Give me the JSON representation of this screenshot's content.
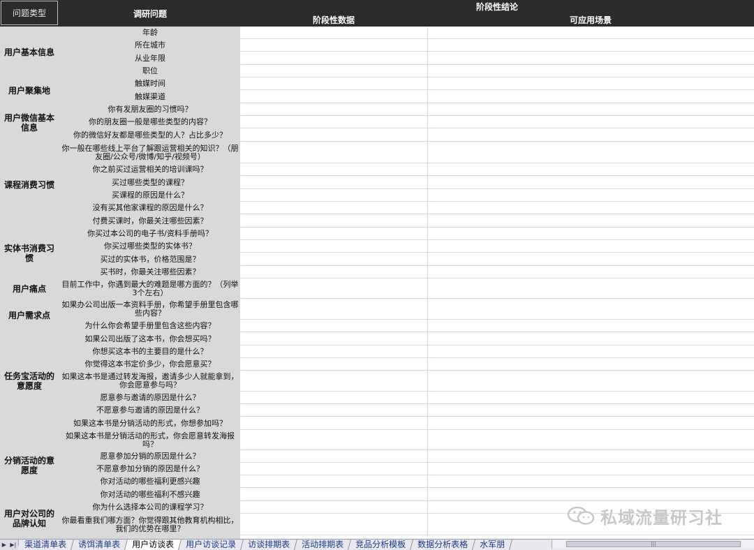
{
  "header": {
    "type_label": "问题类型",
    "question_label": "调研问题",
    "conclusion_label": "阶段性结论",
    "data_label": "阶段性数据",
    "scenario_label": "可应用场景"
  },
  "questions": [
    "年龄",
    "所在城市",
    "从业年限",
    "职位",
    "触媒时间",
    "触媒渠道",
    "你有发朋友圈的习惯吗？",
    "你的朋友圈一般是哪些类型的内容？",
    "你的微信好友都是哪些类型的人？占比多少？",
    "你一般在哪些线上平台了解跟运营相关的知识？（朋友圈/公众号/微博/知乎/视频号）",
    "你之前买过运营相关的培训课吗？",
    "买过哪些类型的课程？",
    "买课程的原因是什么？",
    "没有买其他家课程的原因是什么？",
    "付费买课时，你最关注哪些因素？",
    "你买过本公司的电子书/资料手册吗？",
    "你买过哪些类型的实体书？",
    "买过的实体书，价格范围是？",
    "买书时，你最关注哪些因素？",
    "目前工作中，你遇到最大的难题是哪方面的？（列举3个左右）",
    "如果办公司出版一本资料手册，你希望手册里包含哪些内容？",
    "为什么你会希望手册里包含这些内容？",
    "如果公司出版了这本书，你会想买吗？",
    "你想买这本书的主要目的是什么？",
    "你觉得这本书定价多少，你会愿意买？",
    "如果这本书是通过转发海报，邀请多少人就能拿到，你会愿意参与吗？",
    "愿意参与邀请的原因是什么？",
    "不愿意参与邀请的原因是什么？",
    "如果这本书是分销活动的形式，你想参加吗？",
    "如果这本书是分销活动的形式，你会愿意转发海报吗？",
    "愿意参加分销的原因是什么？",
    "不愿意参加分销的原因是什么？",
    "你对活动的哪些福利更感兴趣",
    "你对活动的哪些福利不感兴趣",
    "你为什么选择本公司的课程学习？",
    "你最看重我们哪方面？你觉得跟其他教育机构相比，我们的优势在哪里？"
  ],
  "groups": [
    "用户基本信息",
    "用户聚集地",
    "用户微信基本信息",
    "课程消费习惯",
    "实体书消费习惯",
    "用户痛点",
    "用户需求点",
    "任务宝活动的意愿度",
    "分销活动的意愿度",
    "用户对公司的品牌认知"
  ],
  "tabs": [
    "渠道清单表",
    "诱饵清单表",
    "用户访谈表",
    "用户访谈记录",
    "访谈排期表",
    "活动排期表",
    "竞品分析模板",
    "数据分析表格",
    "水军朋"
  ],
  "active_tab": "用户访谈表",
  "watermark": "私域流量研习社"
}
